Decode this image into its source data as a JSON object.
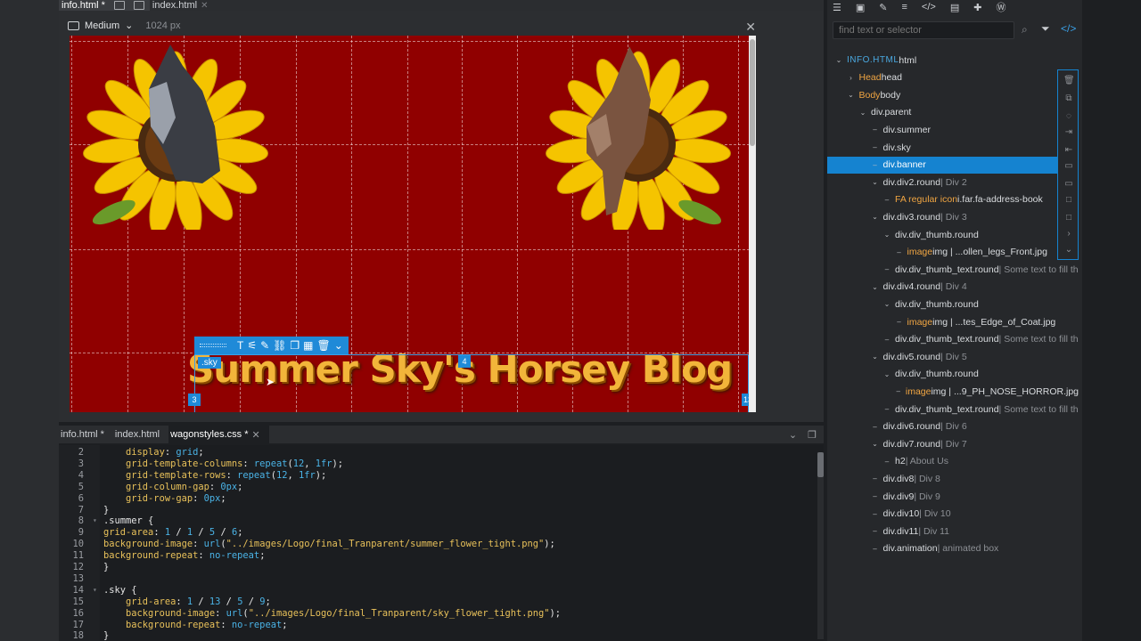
{
  "top_tabs": [
    {
      "label": "info.html *",
      "active": true
    },
    {
      "label": "index.html",
      "active": false
    }
  ],
  "viewport": {
    "label": "Medium",
    "width_text": "1024 px"
  },
  "banner": {
    "text": "Summer Sky's Horsey Blog",
    "tag": ".sky",
    "badges": [
      "4",
      "3",
      "13"
    ]
  },
  "editor_tabs": [
    {
      "label": "info.html *",
      "active": false
    },
    {
      "label": "index.html",
      "active": false
    },
    {
      "label": "wagonstyles.css *",
      "active": true
    }
  ],
  "code_lines": [
    {
      "n": "2",
      "fold": "",
      "parts": [
        [
          "plain",
          "    "
        ],
        [
          "prop",
          "display"
        ],
        [
          "plain",
          ": "
        ],
        [
          "val",
          "grid"
        ],
        [
          "plain",
          ";"
        ]
      ]
    },
    {
      "n": "3",
      "fold": "",
      "parts": [
        [
          "plain",
          "    "
        ],
        [
          "prop",
          "grid-template-columns"
        ],
        [
          "plain",
          ": "
        ],
        [
          "val",
          "repeat"
        ],
        [
          "plain",
          "("
        ],
        [
          "val",
          "12"
        ],
        [
          "plain",
          ", "
        ],
        [
          "val",
          "1fr"
        ],
        [
          "plain",
          ");"
        ]
      ]
    },
    {
      "n": "4",
      "fold": "",
      "parts": [
        [
          "plain",
          "    "
        ],
        [
          "prop",
          "grid-template-rows"
        ],
        [
          "plain",
          ": "
        ],
        [
          "val",
          "repeat"
        ],
        [
          "plain",
          "("
        ],
        [
          "val",
          "12"
        ],
        [
          "plain",
          ", "
        ],
        [
          "val",
          "1fr"
        ],
        [
          "plain",
          ");"
        ]
      ]
    },
    {
      "n": "5",
      "fold": "",
      "parts": [
        [
          "plain",
          "    "
        ],
        [
          "prop",
          "grid-column-gap"
        ],
        [
          "plain",
          ": "
        ],
        [
          "val",
          "0px"
        ],
        [
          "plain",
          ";"
        ]
      ]
    },
    {
      "n": "6",
      "fold": "",
      "parts": [
        [
          "plain",
          "    "
        ],
        [
          "prop",
          "grid-row-gap"
        ],
        [
          "plain",
          ": "
        ],
        [
          "val",
          "0px"
        ],
        [
          "plain",
          ";"
        ]
      ]
    },
    {
      "n": "7",
      "fold": "",
      "parts": [
        [
          "plain",
          "}"
        ]
      ]
    },
    {
      "n": "8",
      "fold": "v",
      "parts": [
        [
          "sel",
          ".summer {"
        ]
      ]
    },
    {
      "n": "9",
      "fold": "",
      "parts": [
        [
          "prop",
          "grid-area"
        ],
        [
          "plain",
          ": "
        ],
        [
          "val",
          "1"
        ],
        [
          "plain",
          " / "
        ],
        [
          "val",
          "1"
        ],
        [
          "plain",
          " / "
        ],
        [
          "val",
          "5"
        ],
        [
          "plain",
          " / "
        ],
        [
          "val",
          "6"
        ],
        [
          "plain",
          ";"
        ]
      ]
    },
    {
      "n": "10",
      "fold": "",
      "parts": [
        [
          "prop",
          "background-image"
        ],
        [
          "plain",
          ": "
        ],
        [
          "val",
          "url"
        ],
        [
          "plain",
          "("
        ],
        [
          "str",
          "\"../images/Logo/final_Tranparent/summer_flower_tight.png\""
        ],
        [
          "plain",
          ");"
        ]
      ]
    },
    {
      "n": "11",
      "fold": "",
      "parts": [
        [
          "prop",
          "background-repeat"
        ],
        [
          "plain",
          ": "
        ],
        [
          "val",
          "no-repeat"
        ],
        [
          "plain",
          ";"
        ]
      ]
    },
    {
      "n": "12",
      "fold": "",
      "parts": [
        [
          "plain",
          "}"
        ]
      ]
    },
    {
      "n": "13",
      "fold": "",
      "parts": [
        [
          "plain",
          ""
        ]
      ]
    },
    {
      "n": "14",
      "fold": "v",
      "parts": [
        [
          "sel",
          ".sky {"
        ]
      ]
    },
    {
      "n": "15",
      "fold": "",
      "parts": [
        [
          "plain",
          "    "
        ],
        [
          "prop",
          "grid-area"
        ],
        [
          "plain",
          ": "
        ],
        [
          "val",
          "1"
        ],
        [
          "plain",
          " / "
        ],
        [
          "val",
          "13"
        ],
        [
          "plain",
          " / "
        ],
        [
          "val",
          "5"
        ],
        [
          "plain",
          " / "
        ],
        [
          "val",
          "9"
        ],
        [
          "plain",
          ";"
        ]
      ]
    },
    {
      "n": "16",
      "fold": "",
      "parts": [
        [
          "plain",
          "    "
        ],
        [
          "prop",
          "background-image"
        ],
        [
          "plain",
          ": "
        ],
        [
          "val",
          "url"
        ],
        [
          "plain",
          "("
        ],
        [
          "str",
          "\"../images/Logo/final_Tranparent/sky_flower_tight.png\""
        ],
        [
          "plain",
          ");"
        ]
      ]
    },
    {
      "n": "17",
      "fold": "",
      "parts": [
        [
          "plain",
          "    "
        ],
        [
          "prop",
          "background-repeat"
        ],
        [
          "plain",
          ": "
        ],
        [
          "val",
          "no-repeat"
        ],
        [
          "plain",
          ";"
        ]
      ]
    },
    {
      "n": "18",
      "fold": "",
      "parts": [
        [
          "plain",
          "}"
        ]
      ]
    }
  ],
  "search": {
    "placeholder": "find text or selector"
  },
  "tree": [
    {
      "indent": 0,
      "caret": "v",
      "label": "INFO.HTML",
      "suffix": " html",
      "type": "root"
    },
    {
      "indent": 1,
      "caret": ">",
      "label": "Head",
      "suffix": " head",
      "type": "orange"
    },
    {
      "indent": 1,
      "caret": "v",
      "label": "Body",
      "suffix": " body",
      "type": "orange"
    },
    {
      "indent": 2,
      "caret": "v",
      "label": "div.parent",
      "suffix": "",
      "type": "plain"
    },
    {
      "indent": 3,
      "caret": "-",
      "label": "div.summer",
      "suffix": "",
      "type": "plain"
    },
    {
      "indent": 3,
      "caret": "-",
      "label": "div.sky",
      "suffix": "",
      "type": "plain"
    },
    {
      "indent": 3,
      "caret": "-",
      "label": "div.banner",
      "suffix": "",
      "type": "plain",
      "selected": true
    },
    {
      "indent": 3,
      "caret": "v",
      "label": "div.div2.round",
      "suffix": " | Div 2",
      "type": "plain"
    },
    {
      "indent": 4,
      "caret": "-",
      "label": "FA regular icon",
      "suffix": " i.far.fa-address-book",
      "type": "orange"
    },
    {
      "indent": 3,
      "caret": "v",
      "label": "div.div3.round",
      "suffix": " | Div 3",
      "type": "plain"
    },
    {
      "indent": 4,
      "caret": "v",
      "label": "div.div_thumb.round",
      "suffix": "",
      "type": "plain"
    },
    {
      "indent": 5,
      "caret": "-",
      "label": "image",
      "suffix": " img | ...ollen_legs_Front.jpg",
      "type": "orange"
    },
    {
      "indent": 4,
      "caret": "-",
      "label": "div.div_thumb_text.round",
      "suffix": " | Some text to fill th",
      "type": "plain"
    },
    {
      "indent": 3,
      "caret": "v",
      "label": "div.div4.round",
      "suffix": " | Div 4",
      "type": "plain"
    },
    {
      "indent": 4,
      "caret": "v",
      "label": "div.div_thumb.round",
      "suffix": "",
      "type": "plain"
    },
    {
      "indent": 5,
      "caret": "-",
      "label": "image",
      "suffix": " img | ...tes_Edge_of_Coat.jpg",
      "type": "orange"
    },
    {
      "indent": 4,
      "caret": "-",
      "label": "div.div_thumb_text.round",
      "suffix": " | Some text to fill th",
      "type": "plain"
    },
    {
      "indent": 3,
      "caret": "v",
      "label": "div.div5.round",
      "suffix": " | Div 5",
      "type": "plain"
    },
    {
      "indent": 4,
      "caret": "v",
      "label": "div.div_thumb.round",
      "suffix": "",
      "type": "plain"
    },
    {
      "indent": 5,
      "caret": "-",
      "label": "image",
      "suffix": " img | ...9_PH_NOSE_HORROR.jpg",
      "type": "orange"
    },
    {
      "indent": 4,
      "caret": "-",
      "label": "div.div_thumb_text.round",
      "suffix": " | Some text to fill th",
      "type": "plain"
    },
    {
      "indent": 3,
      "caret": "-",
      "label": "div.div6.round",
      "suffix": " | Div 6",
      "type": "plain"
    },
    {
      "indent": 3,
      "caret": "v",
      "label": "div.div7.round",
      "suffix": " | Div 7",
      "type": "plain"
    },
    {
      "indent": 4,
      "caret": "-",
      "label": "h2",
      "suffix": " | About Us",
      "type": "plain"
    },
    {
      "indent": 3,
      "caret": "-",
      "label": "div.div8",
      "suffix": " | Div 8",
      "type": "plain"
    },
    {
      "indent": 3,
      "caret": "-",
      "label": "div.div9",
      "suffix": " | Div 9",
      "type": "plain"
    },
    {
      "indent": 3,
      "caret": "-",
      "label": "div.div10",
      "suffix": " | Div 10",
      "type": "plain"
    },
    {
      "indent": 3,
      "caret": "-",
      "label": "div.div11",
      "suffix": " | Div 11",
      "type": "plain"
    },
    {
      "indent": 3,
      "caret": "-",
      "label": "div.animation",
      "suffix": " | animated box",
      "type": "plain"
    }
  ],
  "colors": {
    "page_bg": "#900000",
    "selection": "#1583d0",
    "banner_text": "#f2b53a"
  }
}
